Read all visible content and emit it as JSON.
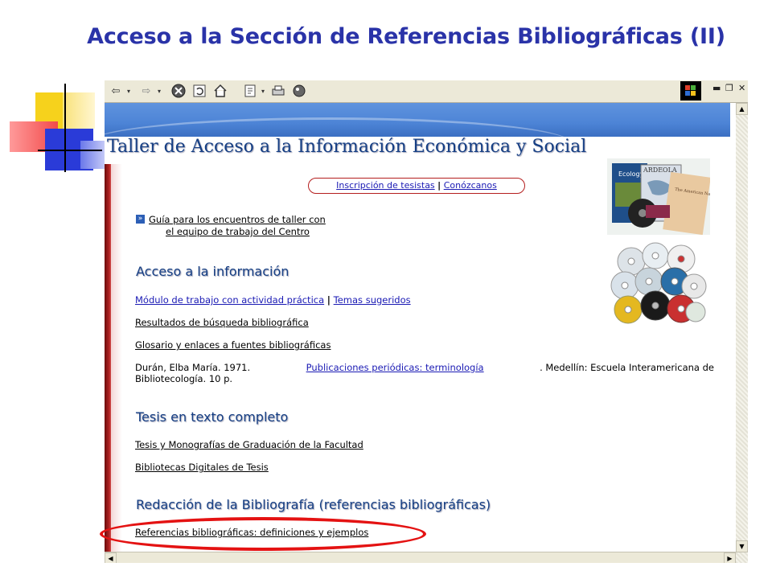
{
  "slide": {
    "title": "Acceso a la Sección de Referencias Bibliográficas (II)"
  },
  "browser": {
    "toolbar_icons": [
      "back-arrow-icon",
      "dropdown-icon",
      "forward-arrow-icon",
      "dropdown-icon",
      "stop-icon",
      "refresh-icon",
      "home-icon",
      "edit-icon",
      "print-icon",
      "messenger-icon"
    ],
    "window_controls": [
      "minimize-icon",
      "restore-icon",
      "close-icon"
    ]
  },
  "page": {
    "heading": "Taller de Acceso a la Información Económica y Social",
    "top_links": {
      "link1": "Inscripción de tesistas",
      "separator": "|",
      "link2": "Conózcanos"
    },
    "guide": {
      "line1": "Guía para los encuentros de taller con",
      "line2": "el equipo de trabajo del Centro"
    },
    "section1": {
      "title": "Acceso a la información",
      "link1": "Módulo de trabajo con actividad práctica",
      "separator": "|",
      "link2": "Temas sugeridos",
      "link3": "Resultados de búsqueda bibliográfica",
      "link4": "Glosario y enlaces a fuentes bibliográficas",
      "citation": {
        "author": "Durán, Elba María. 1971.",
        "title_link": "Publicaciones periódicas: terminología",
        "rest": ". Medellín: Escuela Interamericana de",
        "line2": "Bibliotecología. 10 p."
      }
    },
    "section2": {
      "title": "Tesis en texto completo",
      "link1": "Tesis y Monografías de Graduación de la Facultad",
      "link2": "Bibliotecas Digitales de Tesis"
    },
    "section3": {
      "title": "Redacción de la Bibliografía (referencias bibliográficas)",
      "link1": "Referencias bibliográficas: definiciones y ejemplos"
    },
    "book_covers": {
      "ecology": "Ecology",
      "ardeola": "ARDEOLA",
      "naturalist": "The American Naturalist"
    }
  },
  "colors": {
    "title": "#2a33a8",
    "link": "#1a1ab4",
    "heading": "#163f84",
    "highlight_circle": "#e41212"
  }
}
